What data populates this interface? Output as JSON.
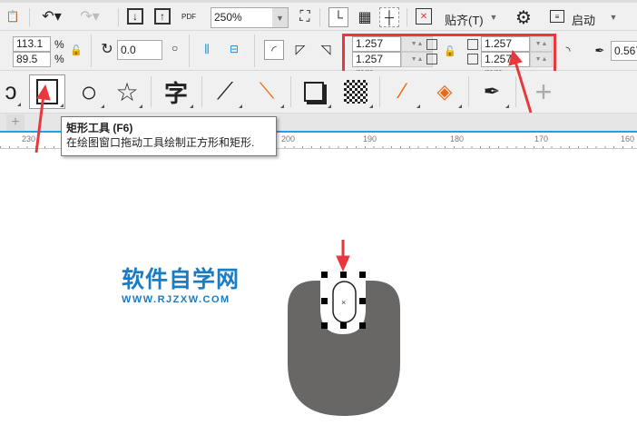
{
  "toolbar": {
    "zoom_value": "250%",
    "snap_label": "贴齐(T)",
    "launch_label": "启动",
    "pdf_label": "PDF"
  },
  "property_bar": {
    "scale_x": "113.1",
    "scale_y": "89.5",
    "percent": "%",
    "rotation": "0.0",
    "degree": "°",
    "corner_tl": "1.257 mm",
    "corner_bl": "1.257 mm",
    "corner_tr": "1.257 mm",
    "corner_br": "1.257 mm",
    "outline_width": "0.567"
  },
  "tooltip": {
    "title": "矩形工具 (F6)",
    "description": "在绘图窗口拖动工具绘制正方形和矩形."
  },
  "ruler": {
    "ticks": [
      "230",
      "200",
      "190",
      "180",
      "170",
      "160"
    ]
  },
  "watermark": {
    "title": "软件自学网",
    "url": "WWW.RJZXW.COM"
  },
  "colors": {
    "accent": "#1a7cc2",
    "highlight": "#e8383d",
    "shape": "#686766"
  }
}
